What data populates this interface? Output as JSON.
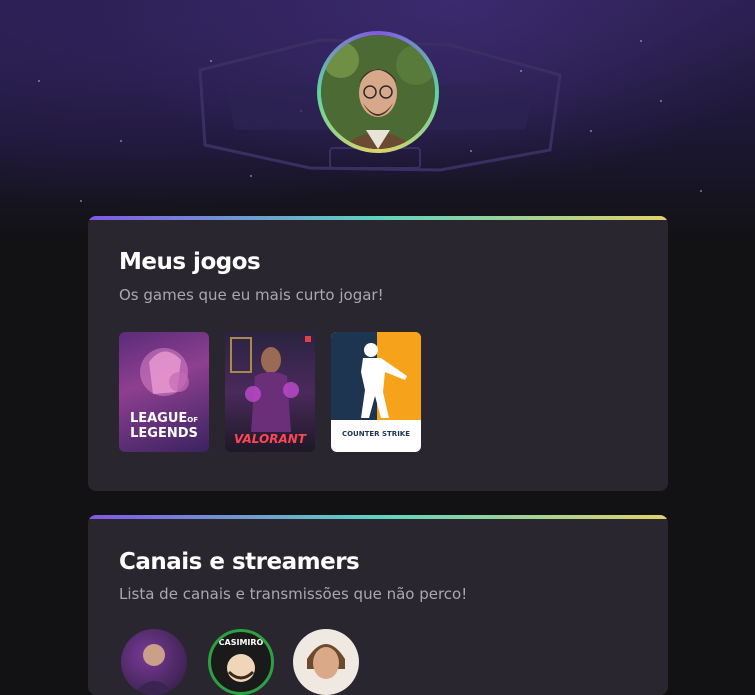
{
  "profile": {
    "avatar_icon": "person-avatar",
    "ring_colors": [
      "#8257e5",
      "#5fd3a0",
      "#e1d26a"
    ]
  },
  "games_section": {
    "title": "Meus jogos",
    "subtitle": "Os games que eu mais curto jogar!",
    "games": [
      {
        "name": "League of Legends",
        "cover_text_1": "LEAGUE",
        "cover_text_2": "LEGENDS",
        "cover_of": "OF"
      },
      {
        "name": "Valorant",
        "cover_text": "VALORANT"
      },
      {
        "name": "Counter-Strike",
        "cover_text_1": "COUNTER",
        "cover_text_2": "STRIKE"
      }
    ]
  },
  "streamers_section": {
    "title": "Canais e streamers",
    "subtitle": "Lista de canais e transmissões que não perco!",
    "streamers": [
      {
        "avatar_icon": "streamer-avatar"
      },
      {
        "avatar_icon": "casimiro-avatar",
        "badge_text": "CASIMIRO"
      },
      {
        "avatar_icon": "streamer-avatar"
      }
    ]
  },
  "colors": {
    "card_bg": "#29262f",
    "page_bg": "#121214",
    "accent_gradient": [
      "#8257e5",
      "#5fd3c0",
      "#e1d26a"
    ]
  }
}
